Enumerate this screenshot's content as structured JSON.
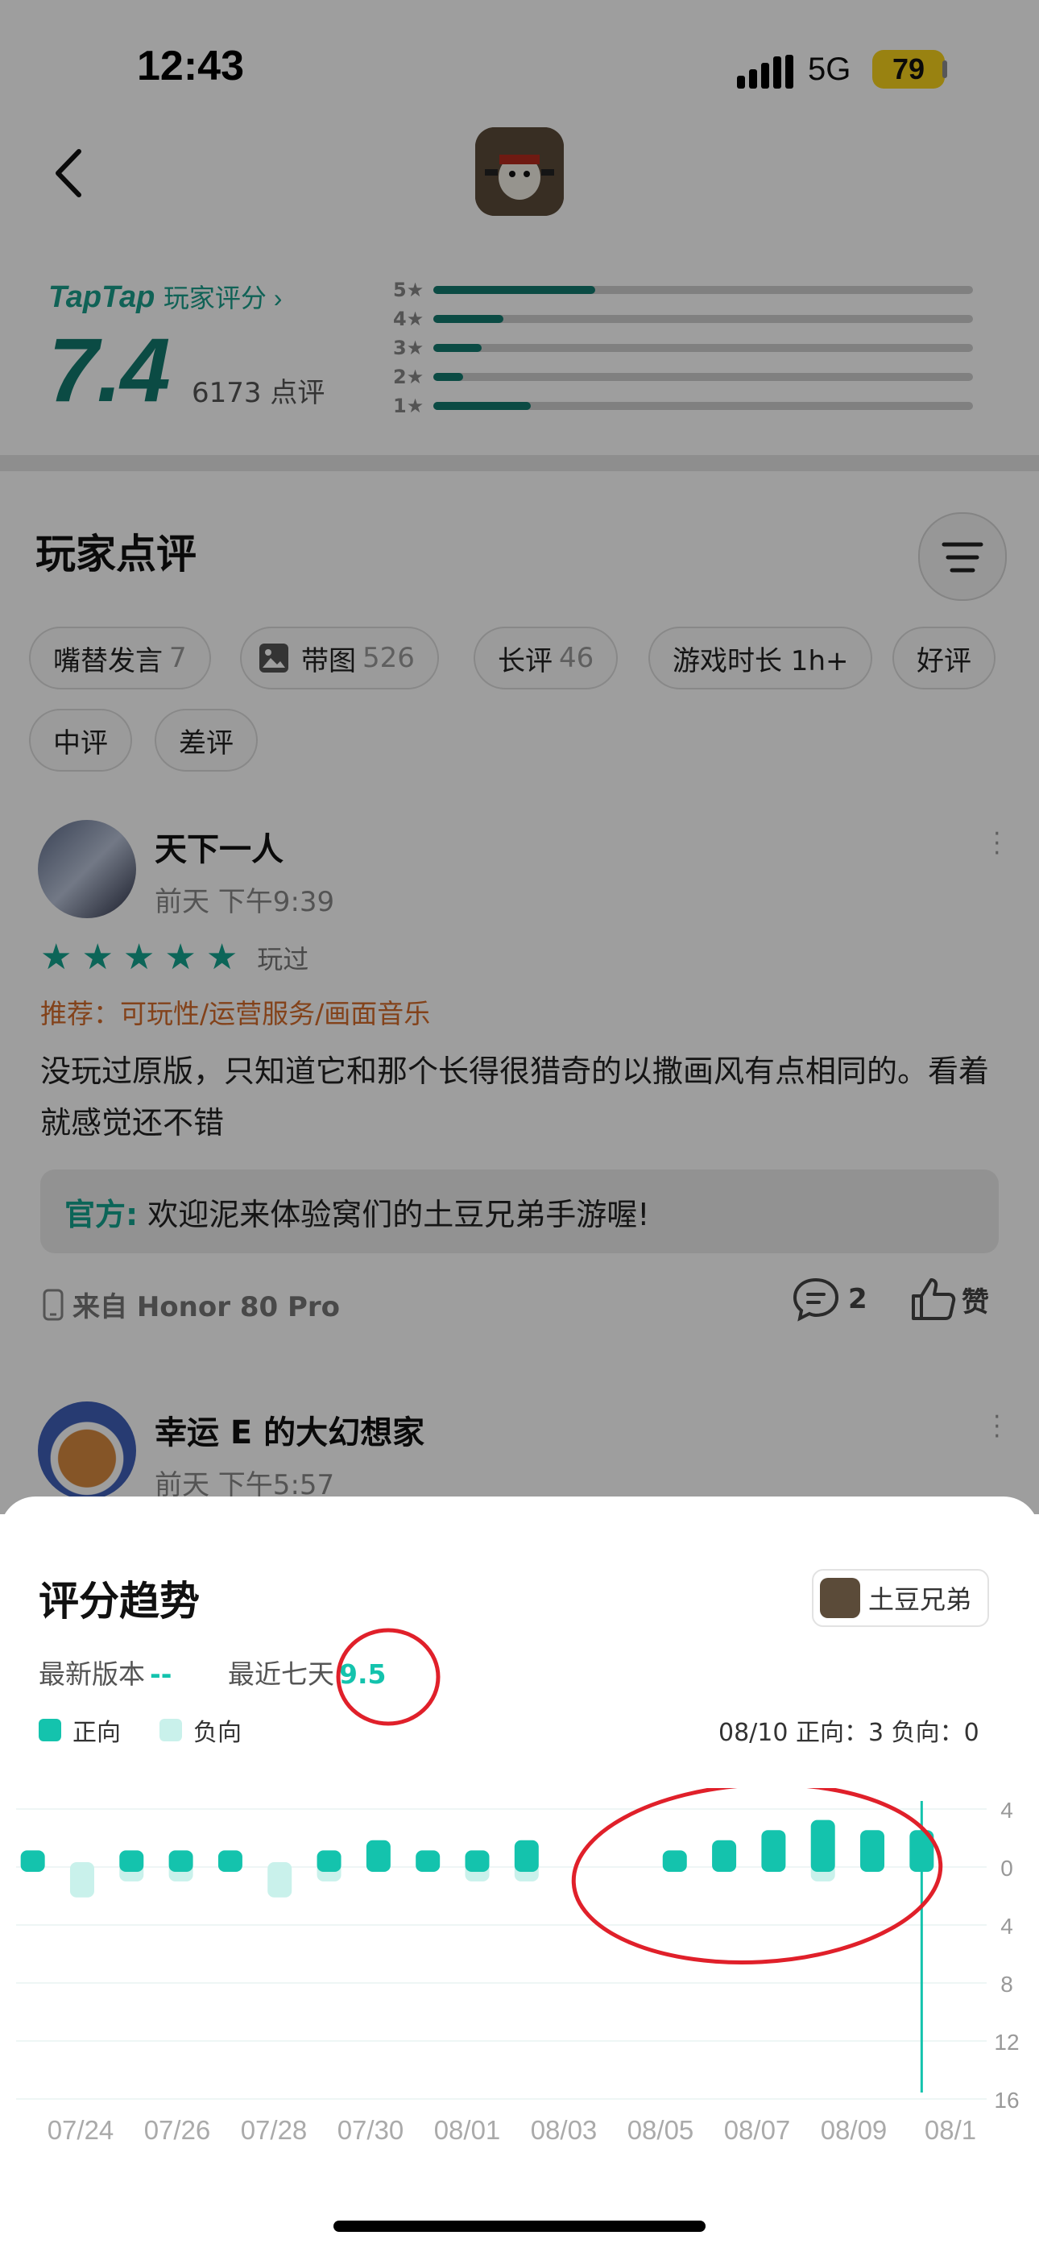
{
  "status": {
    "time": "12:43",
    "network": "5G",
    "battery": "79"
  },
  "rating": {
    "brand": "TapTap",
    "label": "玩家评分 ›",
    "score": "7.4",
    "count": "6173 点评",
    "distribution": [
      {
        "label": "5★",
        "fraction": 0.3
      },
      {
        "label": "4★",
        "fraction": 0.13
      },
      {
        "label": "3★",
        "fraction": 0.09
      },
      {
        "label": "2★",
        "fraction": 0.055
      },
      {
        "label": "1★",
        "fraction": 0.18
      }
    ]
  },
  "reviews_section": {
    "title": "玩家点评"
  },
  "chips": [
    {
      "label": "嘴替发言",
      "count": "7"
    },
    {
      "label": "带图",
      "count": "526"
    },
    {
      "label": "长评",
      "count": "46"
    },
    {
      "label": "游戏时长 1h+",
      "count": ""
    },
    {
      "label": "好评",
      "count": ""
    },
    {
      "label": "中评",
      "count": ""
    },
    {
      "label": "差评",
      "count": ""
    }
  ],
  "review1": {
    "user": "天下一人",
    "time": "前天 下午9:39",
    "stars": 5,
    "played": "玩过",
    "recommend": "推荐：可玩性/运营服务/画面音乐",
    "text": "没玩过原版，只知道它和那个长得很猎奇的以撒画风有点相同的。看着就感觉还不错",
    "official_label": "官方:",
    "official_text": "欢迎泥来体验窝们的土豆兄弟手游喔!",
    "device": "来自 Honor 80 Pro",
    "comments": "2",
    "like": "赞"
  },
  "review2": {
    "user": "幸运 E 的大幻想家",
    "time": "前天 下午5:57"
  },
  "sheet": {
    "title": "评分趋势",
    "game": "土豆兄弟",
    "latest_label": "最新版本",
    "latest_value": "--",
    "week_label": "最近七天",
    "week_value": "9.5",
    "legend_pos": "正向",
    "legend_neg": "负向",
    "hover": "08/10   正向：3   负向：0"
  },
  "colors": {
    "accent": "#14c3ad",
    "neg": "#c9f1eb",
    "annotation": "#e0202a"
  },
  "chart_data": {
    "type": "bar",
    "categories": [
      "07/23",
      "07/24",
      "07/25",
      "07/26",
      "07/27",
      "07/28",
      "07/29",
      "07/30",
      "07/31",
      "08/01",
      "08/02",
      "08/03",
      "08/04",
      "08/05",
      "08/06",
      "08/07",
      "08/08",
      "08/09",
      "08/10"
    ],
    "x_tick_labels": [
      "07/24",
      "07/26",
      "07/28",
      "07/30",
      "08/01",
      "08/03",
      "08/05",
      "08/07",
      "08/09",
      "08/1"
    ],
    "series": [
      {
        "name": "正向",
        "values": [
          1,
          0,
          1,
          1,
          1,
          0,
          1,
          2,
          1,
          1,
          2,
          0,
          0,
          1,
          2,
          3,
          4,
          3,
          3
        ]
      },
      {
        "name": "负向",
        "values": [
          0,
          3,
          1,
          1,
          0,
          3,
          1,
          0,
          0,
          1,
          1,
          0,
          0,
          0,
          0,
          0,
          1,
          0,
          0
        ]
      }
    ],
    "y_tick_labels": [
      "4",
      "0",
      "4",
      "8",
      "12",
      "16"
    ],
    "ylim_pos": 4,
    "ylim_neg": 16,
    "highlight": "08/10"
  }
}
